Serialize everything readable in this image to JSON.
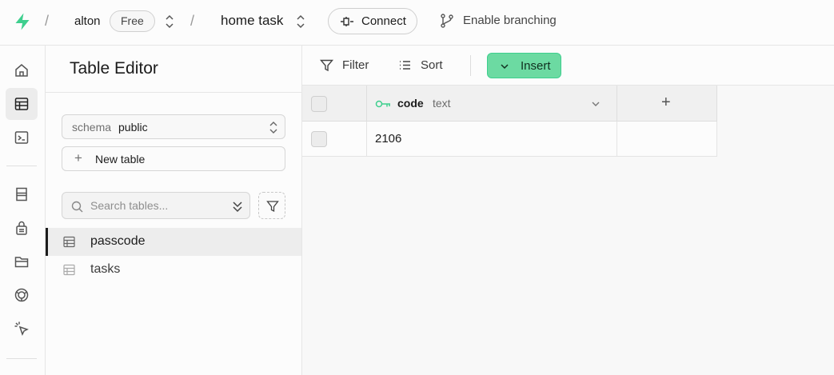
{
  "colors": {
    "brand": "#3ecf8e",
    "insert_bg": "#6cdaa2",
    "text": "#1c1c1c",
    "muted": "#707070"
  },
  "topbar": {
    "logo_icon": "supabase-logo-icon",
    "separator": "/",
    "org_name": "alton",
    "plan_badge": "Free",
    "project_name": "home task",
    "connect_label": "Connect",
    "connect_icon": "plug-icon",
    "branching_label": "Enable branching",
    "branching_icon": "git-branch-icon"
  },
  "rail": {
    "items": [
      {
        "name": "home",
        "icon": "home-icon",
        "active": false
      },
      {
        "name": "table-editor",
        "icon": "table-icon",
        "active": true
      },
      {
        "name": "sql-editor",
        "icon": "terminal-icon",
        "active": false
      },
      {
        "name": "database",
        "icon": "database-icon",
        "active": false
      },
      {
        "name": "authentication",
        "icon": "lock-icon",
        "active": false
      },
      {
        "name": "storage",
        "icon": "folder-icon",
        "active": false
      },
      {
        "name": "realtime",
        "icon": "realtime-icon",
        "active": false
      },
      {
        "name": "advisors",
        "icon": "cursor-click-icon",
        "active": false
      }
    ]
  },
  "sidebar": {
    "title": "Table Editor",
    "schema_label": "schema",
    "schema_value": "public",
    "new_table_label": "New table",
    "search_placeholder": "Search tables...",
    "tables": [
      {
        "label": "passcode",
        "active": true
      },
      {
        "label": "tasks",
        "active": false
      }
    ]
  },
  "toolbar": {
    "filter_label": "Filter",
    "sort_label": "Sort",
    "insert_label": "Insert"
  },
  "grid": {
    "columns": [
      {
        "name": "code",
        "type": "text",
        "primary_key": true
      }
    ],
    "rows": [
      {
        "code": "2106"
      }
    ],
    "add_column_glyph": "+"
  }
}
